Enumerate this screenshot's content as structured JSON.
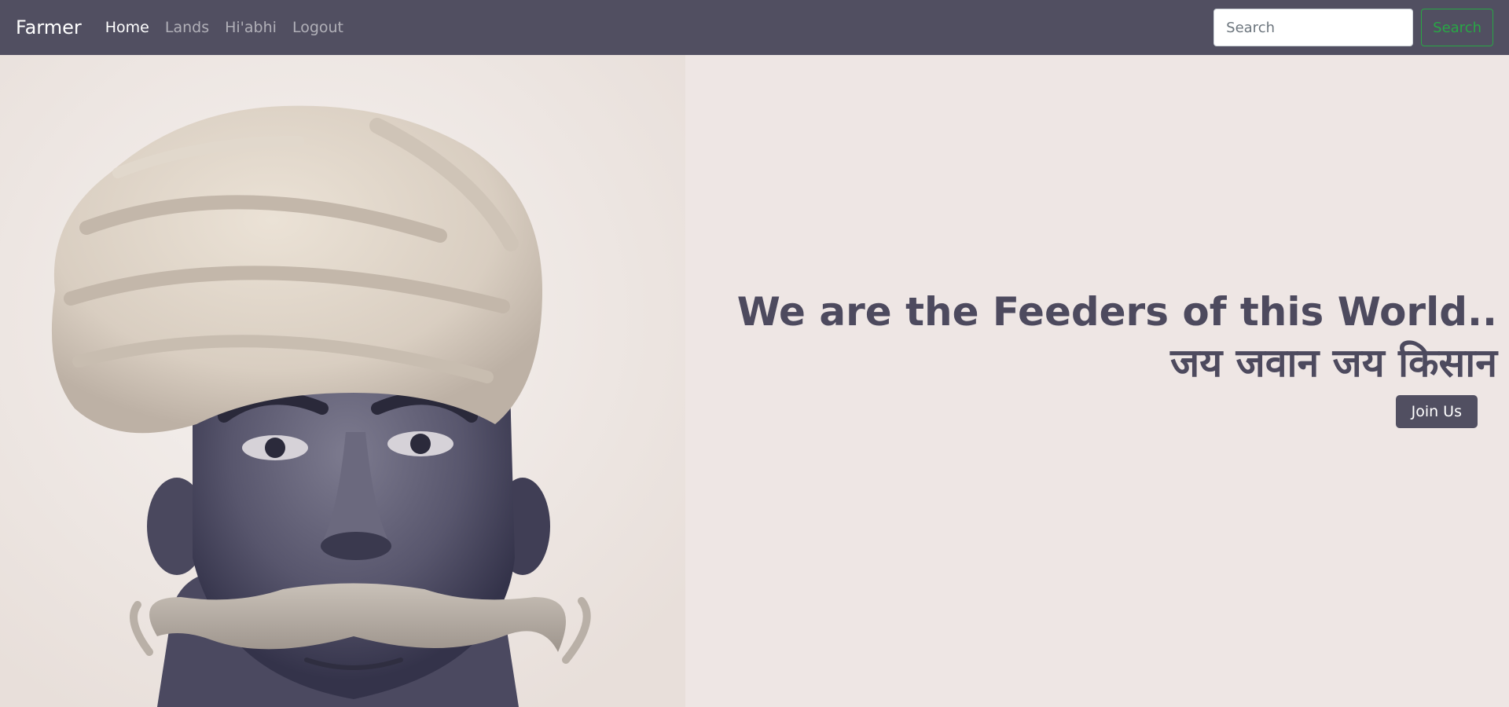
{
  "navbar": {
    "brand": "Farmer",
    "links": [
      {
        "label": "Home",
        "active": true
      },
      {
        "label": "Lands",
        "active": false
      },
      {
        "label": "Hi'abhi",
        "active": false
      },
      {
        "label": "Logout",
        "active": false
      }
    ],
    "search": {
      "placeholder": "Search",
      "value": "",
      "button_label": "Search"
    },
    "colors": {
      "background": "#514f61",
      "search_button": "#28a745"
    }
  },
  "hero": {
    "title": "We are the Feeders of this World..",
    "subtitle": "जय जवान जय किसान",
    "join_button_label": "Join Us",
    "image_subject": "farmer-portrait",
    "colors": {
      "background": "#eee6e4",
      "text": "#4d4a5e"
    }
  }
}
